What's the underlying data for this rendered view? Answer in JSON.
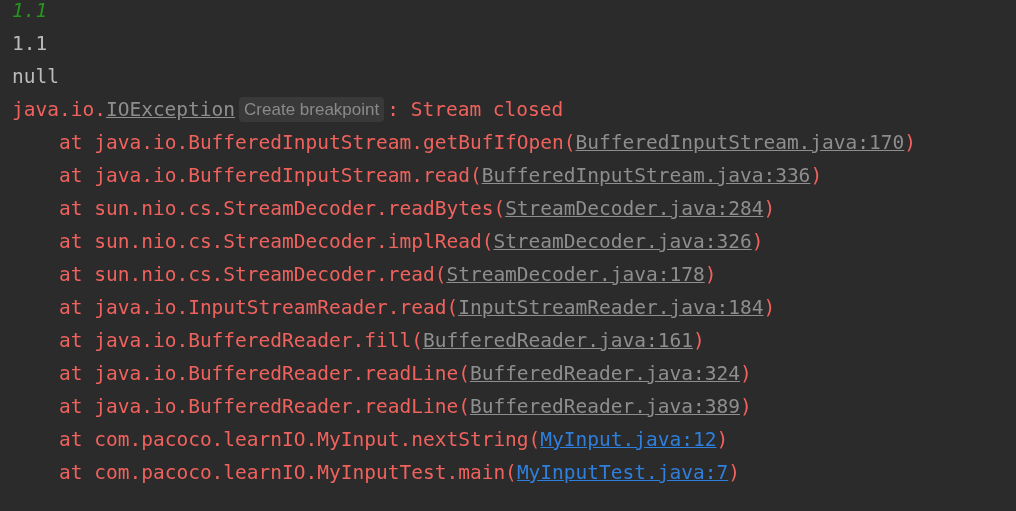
{
  "console_lines": [
    {
      "kind": "input",
      "text": "1.1"
    },
    {
      "kind": "output",
      "text": "1.1"
    },
    {
      "kind": "output",
      "text": "null"
    },
    {
      "kind": "exception",
      "package": "java.io.",
      "class_link": "IOException",
      "hint": "Create breakpoint",
      "message": ": Stream closed"
    },
    {
      "kind": "frame",
      "prefix": "at java.io.BufferedInputStream.getBufIfOpen(",
      "link": "BufferedInputStream.java:170",
      "user_code": false,
      "suffix": ")"
    },
    {
      "kind": "frame",
      "prefix": "at java.io.BufferedInputStream.read(",
      "link": "BufferedInputStream.java:336",
      "user_code": false,
      "suffix": ")"
    },
    {
      "kind": "frame",
      "prefix": "at sun.nio.cs.StreamDecoder.readBytes(",
      "link": "StreamDecoder.java:284",
      "user_code": false,
      "suffix": ")"
    },
    {
      "kind": "frame",
      "prefix": "at sun.nio.cs.StreamDecoder.implRead(",
      "link": "StreamDecoder.java:326",
      "user_code": false,
      "suffix": ")"
    },
    {
      "kind": "frame",
      "prefix": "at sun.nio.cs.StreamDecoder.read(",
      "link": "StreamDecoder.java:178",
      "user_code": false,
      "suffix": ")"
    },
    {
      "kind": "frame",
      "prefix": "at java.io.InputStreamReader.read(",
      "link": "InputStreamReader.java:184",
      "user_code": false,
      "suffix": ")"
    },
    {
      "kind": "frame",
      "prefix": "at java.io.BufferedReader.fill(",
      "link": "BufferedReader.java:161",
      "user_code": false,
      "suffix": ")"
    },
    {
      "kind": "frame",
      "prefix": "at java.io.BufferedReader.readLine(",
      "link": "BufferedReader.java:324",
      "user_code": false,
      "suffix": ")"
    },
    {
      "kind": "frame",
      "prefix": "at java.io.BufferedReader.readLine(",
      "link": "BufferedReader.java:389",
      "user_code": false,
      "suffix": ")"
    },
    {
      "kind": "frame",
      "prefix": "at com.pacoco.learnIO.MyInput.nextString(",
      "link": "MyInput.java:12",
      "user_code": true,
      "suffix": ")"
    },
    {
      "kind": "frame",
      "prefix": "at com.pacoco.learnIO.MyInputTest.main(",
      "link": "MyInputTest.java:7",
      "user_code": true,
      "suffix": ")"
    }
  ]
}
